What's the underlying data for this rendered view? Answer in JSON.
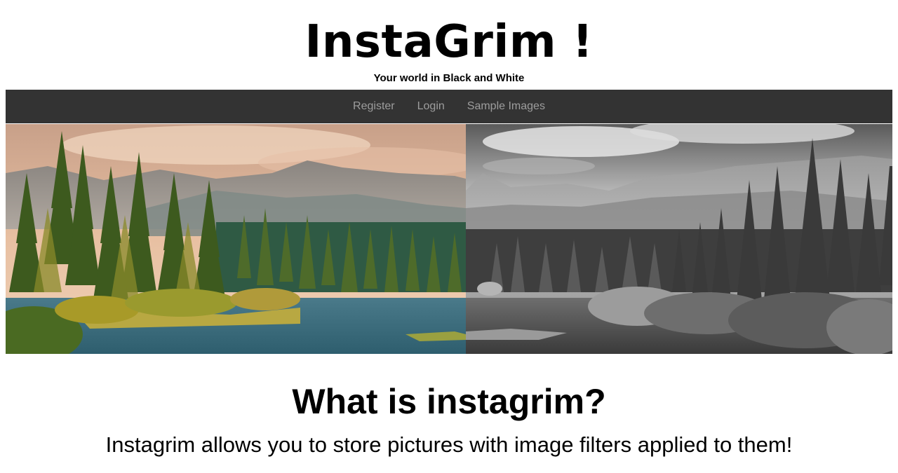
{
  "header": {
    "title": "InstaGrim !",
    "tagline": "Your world in Black and White"
  },
  "nav": {
    "items": [
      {
        "label": "Register"
      },
      {
        "label": "Login"
      },
      {
        "label": "Sample Images"
      }
    ]
  },
  "hero": {
    "description": "split-photo",
    "left_mode": "color",
    "right_mode": "grayscale"
  },
  "main": {
    "heading": "What is instagrim?",
    "text": "Instagrim allows you to store pictures with image filters applied to them!"
  },
  "colors": {
    "navbar_bg": "#333333",
    "nav_link": "#9d9d9d"
  }
}
